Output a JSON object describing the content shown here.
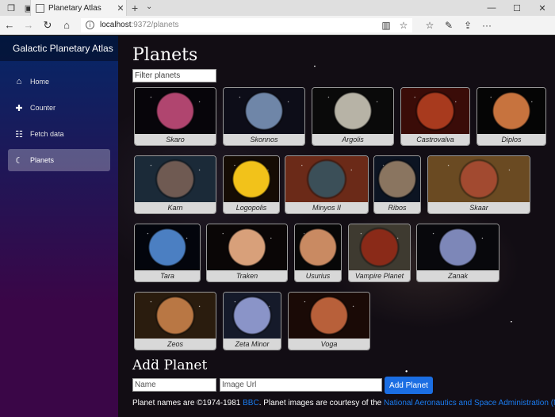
{
  "browser": {
    "tab_title": "Planetary Atlas",
    "url_host": "localhost",
    "url_path": ":9372/planets"
  },
  "sidebar": {
    "brand": "Galactic Planetary Atlas",
    "items": [
      {
        "label": "Home",
        "icon": "home-icon"
      },
      {
        "label": "Counter",
        "icon": "plus-icon"
      },
      {
        "label": "Fetch data",
        "icon": "list-icon"
      },
      {
        "label": "Planets",
        "icon": "moon-icon"
      }
    ]
  },
  "main": {
    "title": "Planets",
    "filter_placeholder": "Filter planets",
    "planets": [
      {
        "name": "Skaro",
        "color": "#b0456f",
        "bg": "#07050a"
      },
      {
        "name": "Skonnos",
        "color": "#6f86a8",
        "bg": "#0d0d18"
      },
      {
        "name": "Argolis",
        "color": "#b7b3a6",
        "bg": "#0a0a0a"
      },
      {
        "name": "Castrovalva",
        "color": "#a83a1e",
        "bg": "#3a0c08"
      },
      {
        "name": "Diplos",
        "color": "#c7733e",
        "bg": "#050505"
      },
      {
        "name": "Karn",
        "color": "#6f5a52",
        "bg": "#1b2a38"
      },
      {
        "name": "Logopolis",
        "color": "#f2c21a",
        "bg": "#150c04"
      },
      {
        "name": "Minyos II",
        "color": "#3b4f58",
        "bg": "#6b2a18"
      },
      {
        "name": "Ribos",
        "color": "#8a7560",
        "bg": "#0c1422"
      },
      {
        "name": "Skaar",
        "color": "#a24a30",
        "bg": "#6a4a22"
      },
      {
        "name": "Tara",
        "color": "#4b7fc2",
        "bg": "#03050c"
      },
      {
        "name": "Traken",
        "color": "#d8a07a",
        "bg": "#0a0606"
      },
      {
        "name": "Usurius",
        "color": "#c98a62",
        "bg": "#070707"
      },
      {
        "name": "Vampire Planet",
        "color": "#8a2a18",
        "bg": "#3e3a30"
      },
      {
        "name": "Zanak",
        "color": "#7d87b8",
        "bg": "#08080c"
      },
      {
        "name": "Zeos",
        "color": "#b97744",
        "bg": "#2a1c0e"
      },
      {
        "name": "Zeta Minor",
        "color": "#8a94c8",
        "bg": "#151a2a"
      },
      {
        "name": "Voga",
        "color": "#b8603a",
        "bg": "#1a0a06"
      }
    ]
  },
  "add_planet": {
    "title": "Add Planet",
    "name_placeholder": "Name",
    "url_placeholder": "Image Url",
    "button_label": "Add Planet"
  },
  "footer": {
    "text1": "Planet names are ©1974-1981 ",
    "link1": "BBC",
    "text2": ". Planet images are courtesy of the ",
    "link2": "National Aeronautics and Space Administration (NASA)",
    "text3": "."
  }
}
